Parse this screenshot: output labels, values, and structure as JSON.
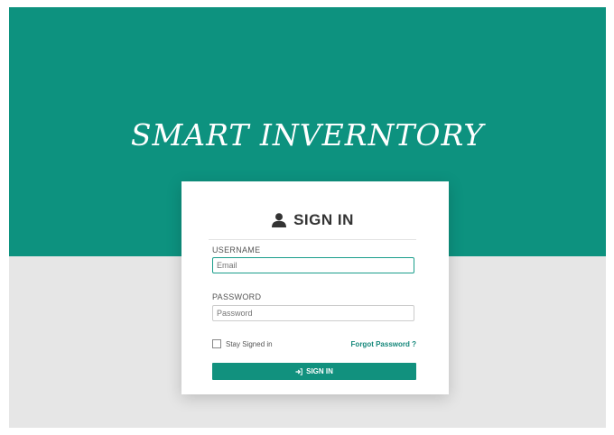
{
  "app": {
    "title": "SMART INVERNTORY"
  },
  "login": {
    "heading": "SIGN IN",
    "username_label": "USERNAME",
    "username_placeholder": "Email",
    "password_label": "PASSWORD",
    "password_placeholder": "Password",
    "remember_label": "Stay Signed in",
    "forgot_label": "Forgot Password ?",
    "button_label": "SIGN IN"
  },
  "icons": {
    "header": "user-icon",
    "button": "sign-in-icon"
  },
  "colors": {
    "brand": "#0d927f",
    "background_lower": "#e6e6e6",
    "link": "#14877a"
  }
}
